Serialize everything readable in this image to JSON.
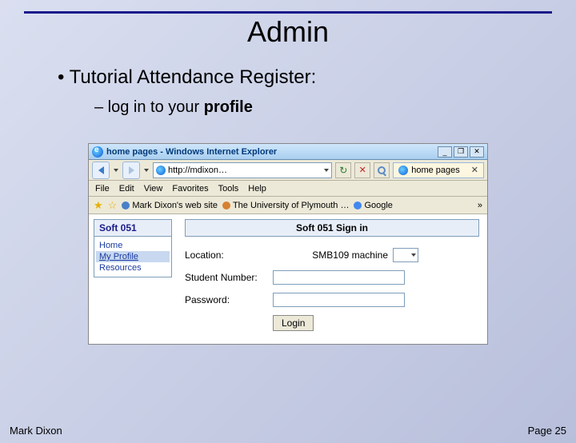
{
  "slide": {
    "title": "Admin",
    "bullet_main": "• Tutorial Attendance Register:",
    "bullet_sub_prefix": "– log in to your ",
    "bullet_sub_bold": "profile"
  },
  "browser": {
    "window_title": "home pages - Windows Internet Explorer",
    "url": "http://mdixon…",
    "tab_label": "home pages",
    "menu": [
      "File",
      "Edit",
      "View",
      "Favorites",
      "Tools",
      "Help"
    ],
    "favs": {
      "link1": "Mark Dixon's web site",
      "link2": "The University of Plymouth …",
      "link3": "Google"
    },
    "overflow": "»"
  },
  "page": {
    "side_header": "Soft 051",
    "nav": {
      "home": "Home",
      "myprofile": "My Profile",
      "resources": "Resources"
    },
    "form_title": "Soft 051 Sign in",
    "labels": {
      "location": "Location:",
      "student_number": "Student Number:",
      "password": "Password:"
    },
    "location_value": "SMB109 machine",
    "login_button": "Login"
  },
  "footer": {
    "author": "Mark Dixon",
    "page": "Page 25"
  }
}
